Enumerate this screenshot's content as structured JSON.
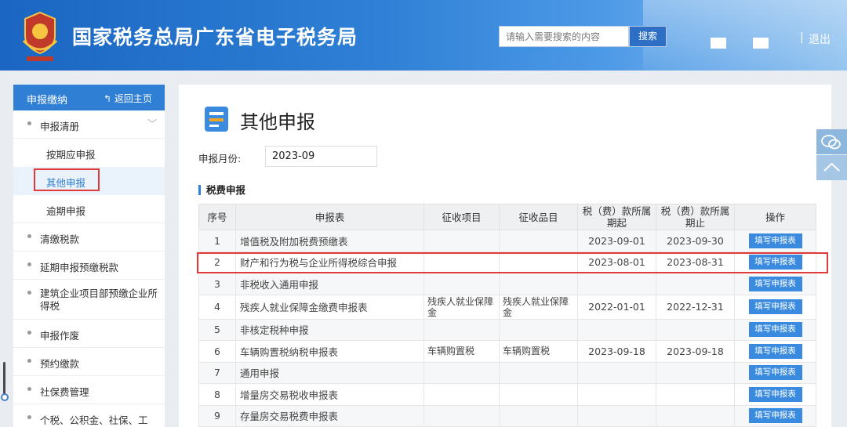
{
  "header": {
    "site_title": "国家税务总局广东省电子税务局",
    "search_placeholder": "请输入需要搜索的内容",
    "search_button": "搜索",
    "separator": "|",
    "logout": "退出"
  },
  "sidebar": {
    "title": "申报缴纳",
    "back_label": "返回主页",
    "items": [
      {
        "label": "申报清册"
      },
      {
        "label": "按期应申报"
      },
      {
        "label": "其他申报"
      },
      {
        "label": "逾期申报"
      },
      {
        "label": "清缴税款"
      },
      {
        "label": "延期申报预缴税款"
      },
      {
        "label": "建筑企业项目部预缴企业所得税"
      },
      {
        "label": "申报作废"
      },
      {
        "label": "预约缴款"
      },
      {
        "label": "社保费管理"
      },
      {
        "label": "个税、公积金、社保、工"
      }
    ]
  },
  "main": {
    "page_title": "其他申报",
    "month_label": "申报月份:",
    "month_value": "2023-09",
    "section_title": "税费申报",
    "table": {
      "headers": [
        "序号",
        "申报表",
        "征收项目",
        "征收品目",
        "税（费）款所属期起",
        "税（费）款所属期止",
        "操作"
      ],
      "rows": [
        {
          "no": "1",
          "name": "增值税及附加税费预缴表",
          "item": "",
          "subitem": "",
          "start": "2023-09-01",
          "end": "2023-09-30",
          "action": "填写申报表"
        },
        {
          "no": "2",
          "name": "财产和行为税与企业所得税综合申报",
          "item": "",
          "subitem": "",
          "start": "2023-08-01",
          "end": "2023-08-31",
          "action": "填写申报表"
        },
        {
          "no": "3",
          "name": "非税收入通用申报",
          "item": "",
          "subitem": "",
          "start": "",
          "end": "",
          "action": "填写申报表"
        },
        {
          "no": "4",
          "name": "残疾人就业保障金缴费申报表",
          "item": "残疾人就业保障金",
          "subitem": "残疾人就业保障金",
          "start": "2022-01-01",
          "end": "2022-12-31",
          "action": "填写申报表"
        },
        {
          "no": "5",
          "name": "非核定税种申报",
          "item": "",
          "subitem": "",
          "start": "",
          "end": "",
          "action": "填写申报表"
        },
        {
          "no": "6",
          "name": "车辆购置税纳税申报表",
          "item": "车辆购置税",
          "subitem": "车辆购置税",
          "start": "2023-09-18",
          "end": "2023-09-18",
          "action": "填写申报表"
        },
        {
          "no": "7",
          "name": "通用申报",
          "item": "",
          "subitem": "",
          "start": "",
          "end": "",
          "action": "填写申报表"
        },
        {
          "no": "8",
          "name": "增量房交易税收申报表",
          "item": "",
          "subitem": "",
          "start": "",
          "end": "",
          "action": "填写申报表"
        },
        {
          "no": "9",
          "name": "存量房交易税费申报表",
          "item": "",
          "subitem": "",
          "start": "",
          "end": "",
          "action": "填写申报表"
        }
      ]
    }
  },
  "colors": {
    "brand_blue": "#2f7fd4",
    "highlight_red": "#e03a3a",
    "button_blue": "#3a8be0"
  }
}
